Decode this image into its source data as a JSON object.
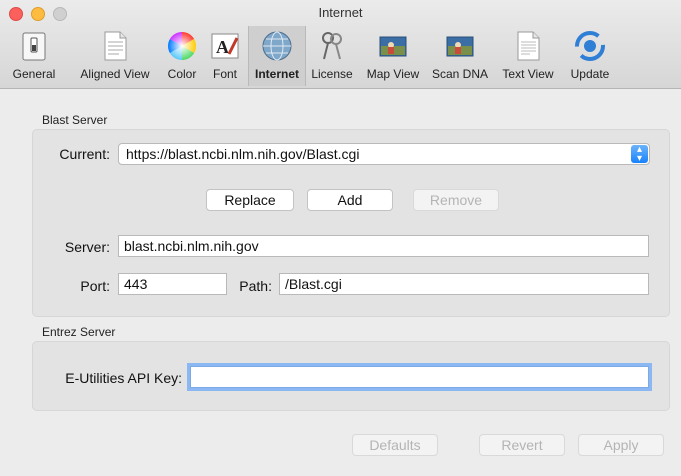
{
  "window": {
    "title": "Internet"
  },
  "toolbar": {
    "items": [
      {
        "label": "General",
        "icon": "general-switch-icon"
      },
      {
        "label": "Aligned View",
        "icon": "aligned-document-icon"
      },
      {
        "label": "Color",
        "icon": "color-wheel-icon"
      },
      {
        "label": "Font",
        "icon": "font-icon"
      },
      {
        "label": "Internet",
        "icon": "globe-icon"
      },
      {
        "label": "License",
        "icon": "keys-icon"
      },
      {
        "label": "Map View",
        "icon": "map-picture-icon"
      },
      {
        "label": "Scan DNA",
        "icon": "scan-picture-icon"
      },
      {
        "label": "Text View",
        "icon": "text-document-icon"
      },
      {
        "label": "Update",
        "icon": "update-icon"
      }
    ],
    "selected": "Internet"
  },
  "blast": {
    "section_title": "Blast Server",
    "current_label": "Current:",
    "current_value": "https://blast.ncbi.nlm.nih.gov/Blast.cgi",
    "replace_label": "Replace",
    "add_label": "Add",
    "remove_label": "Remove",
    "server_label": "Server:",
    "server_value": "blast.ncbi.nlm.nih.gov",
    "port_label": "Port:",
    "port_value": "443",
    "path_label": "Path:",
    "path_value": "/Blast.cgi"
  },
  "entrez": {
    "section_title": "Entrez Server",
    "api_key_label": "E-Utilities API Key:",
    "api_key_value": ""
  },
  "footer": {
    "defaults_label": "Defaults",
    "revert_label": "Revert",
    "apply_label": "Apply"
  }
}
